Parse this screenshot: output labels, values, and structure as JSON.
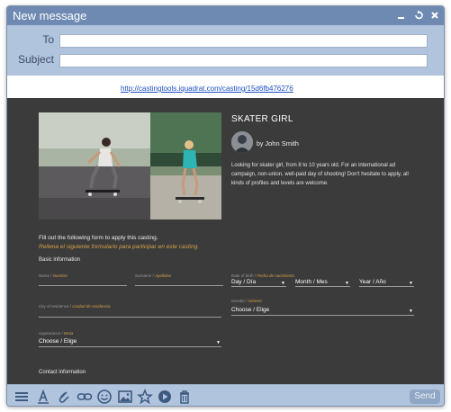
{
  "window": {
    "title": "New message"
  },
  "header": {
    "to_label": "To",
    "to_value": "",
    "subject_label": "Subject",
    "subject_value": ""
  },
  "link": {
    "text": "http://castingtools.iquadrat.com/casting/15d6fb476276"
  },
  "casting": {
    "title": "SKATER GIRL",
    "by_prefix": "by",
    "author": "John Smith",
    "description": "Looking for skater girl, from 8 to 10 years old. For an international ad campaign, non-union, well-paid day of shooting! Don't hesitate to apply, all kinds of profiles and levels are welcome."
  },
  "form": {
    "intro_en": "Fill out the following form to apply this casting.",
    "intro_es": "Rellena el siguiente formulario para participar en este casting.",
    "basic_info": "Basic information",
    "name_en": "Name /",
    "name_es": "Nombre",
    "surname_en": "Surname /",
    "surname_es": "Apellidos",
    "dob_en": "Date of birth /",
    "dob_es": "Fecha de nacimiento",
    "day": "Day / Día",
    "month": "Month / Mes",
    "year": "Year / Año",
    "city_en": "City of residence /",
    "city_es": "Ciudad de residencia",
    "gender_en": "Gender /",
    "gender_es": "Género",
    "gender_value": "Choose / Elige",
    "appearance_en": "Appearance /",
    "appearance_es": "Etnia",
    "appearance_value": "Choose / Elige",
    "contact_info": "Contact information"
  },
  "toolbar": {
    "send_label": "Send",
    "icons": [
      "menu-icon",
      "text-format-icon",
      "attachment-icon",
      "link-icon",
      "emoji-icon",
      "image-icon",
      "star-icon",
      "casting-logo-icon",
      "trash-icon"
    ]
  },
  "colors": {
    "titlebar": "#6e8ab2",
    "chrome": "#b0c4de",
    "content_bg": "#3b3b3b",
    "accent": "#d8a24a",
    "link": "#1a4ec4"
  }
}
